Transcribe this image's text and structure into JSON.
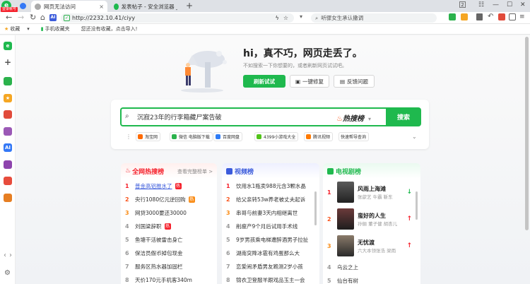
{
  "browser": {
    "badge": "登录帐号",
    "tabs": [
      {
        "title": "网页无法访问",
        "close": "×"
      },
      {
        "title": "发表帖子 - 安全浏览器 _3608..."
      }
    ],
    "new_tab": "+",
    "window_controls": [
      "2",
      "☷",
      "—",
      "☐",
      "✕"
    ],
    "url": "http://2232.10.41/ciyy",
    "search_placeholder": "听骤女生承认撒调",
    "bookmarks": [
      "收藏",
      "手机收藏夹",
      "您还没有收藏，点击导入!"
    ]
  },
  "sidebar": {
    "labels": [
      "AI"
    ]
  },
  "hero": {
    "title": "hi，真不巧，网页走丢了。",
    "subtitle": "不如搜索一下你想要的，或者刷新网页试试吧。",
    "refresh": "刷新试试",
    "repair": "一键修复",
    "feedback": "反馈问题"
  },
  "search": {
    "placeholder": "沉寂23年的行李箱藏尸案告破",
    "hot_label": "热搜榜",
    "button": "搜索",
    "quick_links": [
      "淘宝网",
      "微信 电脑版下载",
      "百度网盘",
      "4399小游戏大全",
      "腾讯视频",
      "快速帮导查询"
    ]
  },
  "hot_list": {
    "title": "全网热搜榜",
    "more": "查看完整榜单 >",
    "items": [
      {
        "rank": "1",
        "text": "普金高铝推水了",
        "tag": "热"
      },
      {
        "rank": "2",
        "text": "央行1080亿元逆回购",
        "tag": "热"
      },
      {
        "rank": "3",
        "text": "网贷3000要还30000"
      },
      {
        "rank": "4",
        "text": "刘国梁辞职",
        "tag": "热"
      },
      {
        "rank": "5",
        "text": "鱼塘干活被雷击身亡"
      },
      {
        "rank": "6",
        "text": "保洁员假币掉包现金"
      },
      {
        "rank": "7",
        "text": "服务区热水器加固栏"
      },
      {
        "rank": "8",
        "text": "天价170元手机客340m"
      }
    ]
  },
  "video_list": {
    "title": "视频榜",
    "items": [
      {
        "rank": "1",
        "text": "饮用水1瓶卖988元含3颗水晶"
      },
      {
        "rank": "2",
        "text": "给父亲转53w养老被丈夫起诉"
      },
      {
        "rank": "3",
        "text": "串哥与前妻3天内相继离世"
      },
      {
        "rank": "4",
        "text": "削瘦产9个月后试用手术线"
      },
      {
        "rank": "5",
        "text": "9岁男孩乘电梯遭醉酒男子拉扯"
      },
      {
        "rank": "6",
        "text": "湖南突降冰雹有鸡蛋那么大"
      },
      {
        "rank": "7",
        "text": "恋爱闹矛盾男友跪测2岁小孩"
      },
      {
        "rank": "8",
        "text": "锦衣卫登服羊跟戏品玉主一会"
      }
    ]
  },
  "drama_list": {
    "title": "电视剧榜",
    "items": [
      {
        "rank": "1",
        "title": "风雨上海滩",
        "cast": "张歆艺 牛霸 靳东",
        "trend": "↓"
      },
      {
        "rank": "2",
        "title": "蛮好的人生",
        "cast": "孙俪 董子健 胡杏儿",
        "trend": "↑"
      },
      {
        "rank": "3",
        "title": "无忧渡",
        "cast": "六大本领张浩 梁雨",
        "trend": "↑"
      },
      {
        "rank": "4",
        "title": "乌云之上"
      },
      {
        "rank": "5",
        "title": "仙台有树"
      }
    ]
  },
  "colors": {
    "accent": "#1fb94e",
    "hot": "#f5222d",
    "video": "#3b5bdb",
    "drama": "#1fb94e"
  }
}
